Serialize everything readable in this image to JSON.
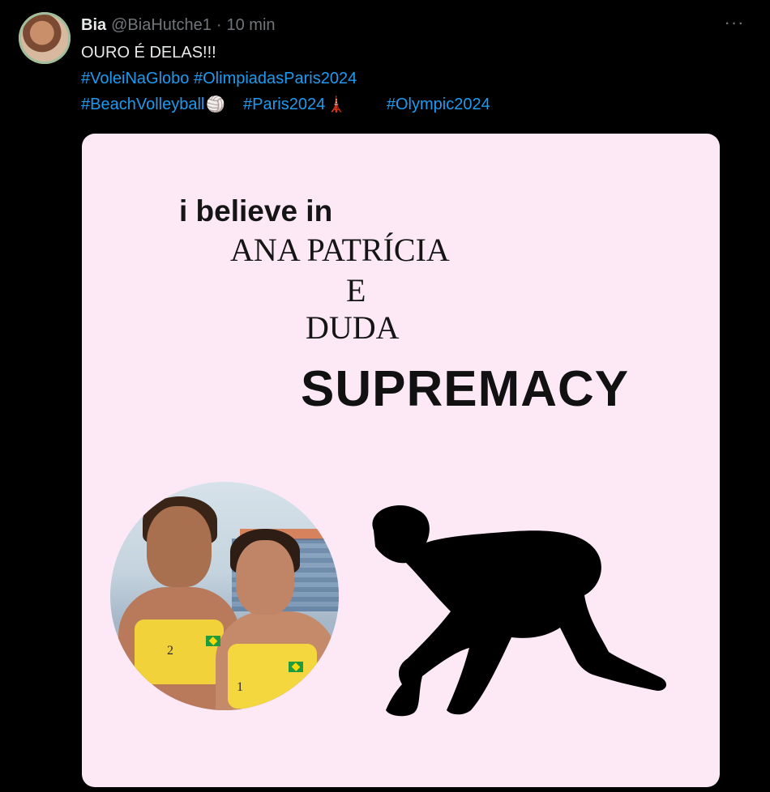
{
  "tweet": {
    "author_name": "Bia",
    "handle": "@BiaHutche1",
    "separator": "·",
    "time": "10 min",
    "more_label": "···",
    "text": "OURO É DELAS!!!",
    "hashtags_line1": [
      "#VoleiNaGlobo",
      "#OlimpiadasParis2024"
    ],
    "hashtags_line2": [
      "#BeachVolleyball",
      "#Paris2024",
      "#Olympic2024"
    ],
    "emoji_volleyball": "🏐",
    "emoji_tower": "🗼"
  },
  "media": {
    "line_believe": "i believe in",
    "line_name1": "ANA PATRÍCIA",
    "line_e": "E",
    "line_name2": "DUDA",
    "line_supremacy": "SUPREMACY",
    "jersey_number_1": "2",
    "jersey_number_2": "1"
  },
  "colors": {
    "background": "#000000",
    "text_primary": "#e7e9ea",
    "text_secondary": "#71767b",
    "link": "#1d9bf0",
    "meme_background": "#fde9f6"
  }
}
